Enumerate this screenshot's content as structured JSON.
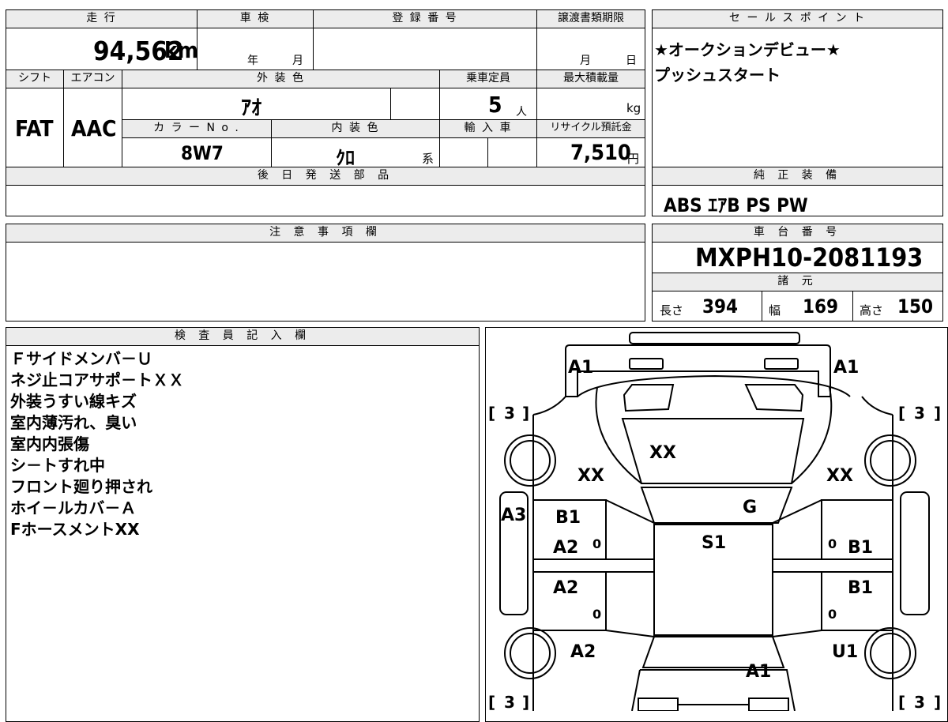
{
  "headers": {
    "mileage": "走 行",
    "shaken": "車 検",
    "registration": "登 録 番 号",
    "transfer_deadline": "譲渡書類期限",
    "sales_point": "セ ー ル ス ポ イ ン ト",
    "shift": "シフト",
    "aircon": "エアコン",
    "exterior_color": "外 装 色",
    "capacity": "乗車定員",
    "max_load": "最大積載量",
    "color_no": "カ ラ ー N o .",
    "interior_color": "内 装 色",
    "import": "輸 入 車",
    "recycle": "リサイクル預託金",
    "later_parts": "後 日 発 送 部 品",
    "genuine_equipment": "純 正 装 備",
    "caution": "注 意 事 項 欄",
    "chassis_number": "車 台 番 号",
    "specs": "諸 元",
    "inspector": "検 査 員 記 入 欄"
  },
  "values": {
    "mileage": "94,562",
    "mileage_unit": "km",
    "year_unit": "年",
    "month_unit": "月",
    "day_unit": "日",
    "shift": "FAT",
    "aircon": "AAC",
    "exterior_color": "ｱｵ",
    "capacity": "5",
    "capacity_unit": "人",
    "load_unit": "kg",
    "color_no": "8W7",
    "interior_color": "ｸﾛ",
    "interior_suffix": "系",
    "recycle": "7,510",
    "recycle_unit": "円",
    "sales_line1": "★オークションデビュー★",
    "sales_line2": "プッシュスタート",
    "equipment": "ABS ｴｱB PS PW",
    "chassis_number": "MXPH10-2081193",
    "length_label": "長さ",
    "length": "394",
    "width_label": "幅",
    "width": "169",
    "height_label": "高さ",
    "height": "150"
  },
  "inspector_notes": [
    "Ｆサイドメンバ－Ｕ",
    "ネジ止コアサポ－トＸＸ",
    "外装うすい線キズ",
    "室内薄汚れ、臭い",
    "室内内張傷",
    "シ－トすれ中",
    "フロント廻り押され",
    "ホイ－ルカバ－Ａ",
    "FホースメントXX"
  ],
  "diagram_marks": {
    "front_left": "A1",
    "front_right": "A1",
    "tire_fl": "3",
    "tire_fr": "3",
    "tire_rl": "3",
    "tire_rr": "3",
    "hood": "XX",
    "fender_left": "XX",
    "fender_right": "XX",
    "windshield": "G",
    "left_pillar": "A3",
    "front_door_left_1": "B1",
    "front_door_left_2": "A2",
    "front_door_right": "B1",
    "roof": "S1",
    "rear_door_left": "A2",
    "rear_door_right": "B1",
    "rear_fender_left": "A2",
    "rear_fender_right": "U1",
    "trunk": "A1",
    "zero": "0"
  }
}
